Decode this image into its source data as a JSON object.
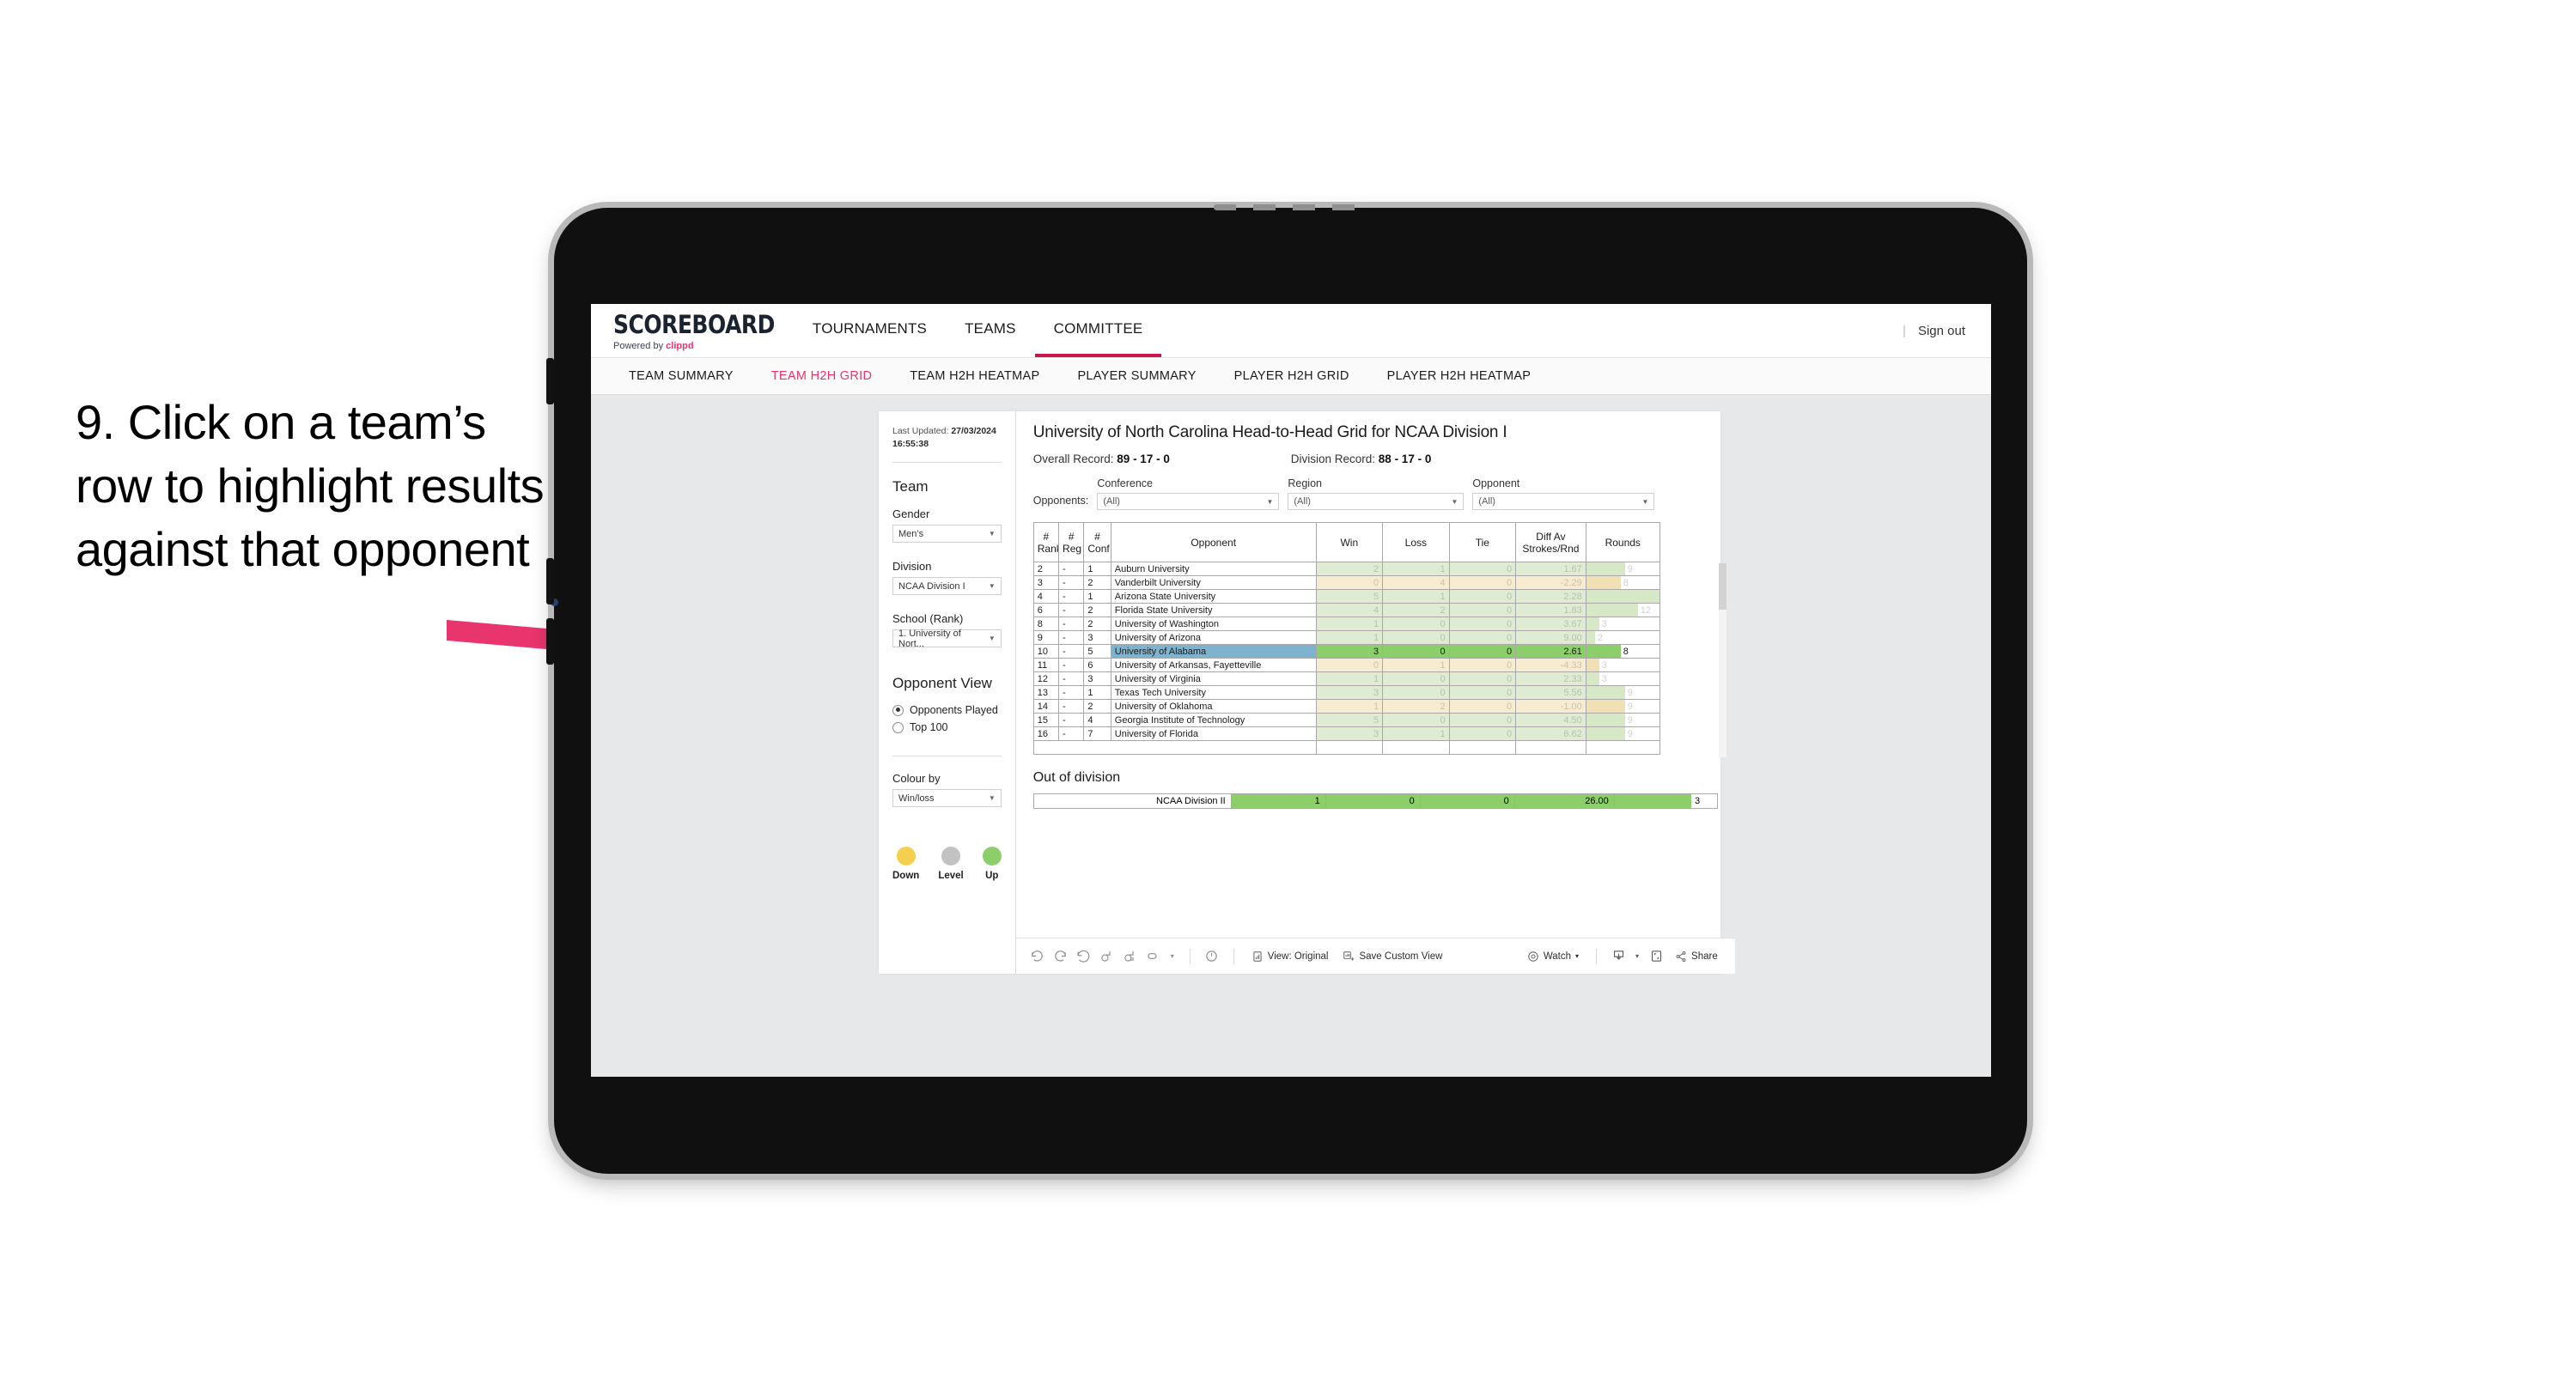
{
  "annotation": {
    "text": "9. Click on a team’s row to highlight results against that opponent",
    "arrow_color": "#e8356d"
  },
  "app": {
    "brand": {
      "title": "SCOREBOARD",
      "powered_prefix": "Powered by ",
      "powered_name": "clippd"
    },
    "topnav": [
      {
        "label": "TOURNAMENTS",
        "active": false
      },
      {
        "label": "TEAMS",
        "active": false
      },
      {
        "label": "COMMITTEE",
        "active": true
      }
    ],
    "topbar_right": {
      "divider": "|",
      "sign_out": "Sign out"
    },
    "subnav": [
      {
        "label": "TEAM SUMMARY",
        "active": false
      },
      {
        "label": "TEAM H2H GRID",
        "active": true
      },
      {
        "label": "TEAM H2H HEATMAP",
        "active": false
      },
      {
        "label": "PLAYER SUMMARY",
        "active": false
      },
      {
        "label": "PLAYER H2H GRID",
        "active": false
      },
      {
        "label": "PLAYER H2H HEATMAP",
        "active": false
      }
    ]
  },
  "sidebar": {
    "last_updated_label": "Last Updated:",
    "last_updated_value": "27/03/2024 16:55:38",
    "team_heading": "Team",
    "gender_label": "Gender",
    "gender_value": "Men’s",
    "division_label": "Division",
    "division_value": "NCAA Division I",
    "school_label": "School (Rank)",
    "school_value": "1. University of Nort...",
    "opponent_view_heading": "Opponent View",
    "opponent_view_options": [
      {
        "label": "Opponents Played",
        "selected": true
      },
      {
        "label": "Top 100",
        "selected": false
      }
    ],
    "colour_by_label": "Colour by",
    "colour_by_value": "Win/loss",
    "legend": [
      {
        "label": "Down",
        "color": "#f5d04e"
      },
      {
        "label": "Level",
        "color": "#c2c2c2"
      },
      {
        "label": "Up",
        "color": "#8cce6a"
      }
    ]
  },
  "viz": {
    "title": "University of North Carolina Head-to-Head Grid for NCAA Division I",
    "overall_record_label": "Overall Record:",
    "overall_record_value": "89 - 17 - 0",
    "division_record_label": "Division Record:",
    "division_record_value": "88 - 17 - 0",
    "opponents_label": "Opponents:",
    "filters": [
      {
        "label": "Conference",
        "value": "(All)"
      },
      {
        "label": "Region",
        "value": "(All)"
      },
      {
        "label": "Opponent",
        "value": "(All)"
      }
    ],
    "columns": [
      {
        "l1": "#",
        "l2": "Rank"
      },
      {
        "l1": "#",
        "l2": "Reg"
      },
      {
        "l1": "#",
        "l2": "Conf"
      },
      {
        "l1": "Opponent",
        "l2": ""
      },
      {
        "l1": "Win",
        "l2": ""
      },
      {
        "l1": "Loss",
        "l2": ""
      },
      {
        "l1": "Tie",
        "l2": ""
      },
      {
        "l1": "Diff Av",
        "l2": "Strokes/Rnd"
      },
      {
        "l1": "Rounds",
        "l2": ""
      }
    ],
    "rows": [
      {
        "rank": "2",
        "reg": "-",
        "conf": "1",
        "opponent": "Auburn University",
        "win": "2",
        "loss": "1",
        "tie": "0",
        "diff": "1.67",
        "rounds": "9",
        "state": "up",
        "selected": false
      },
      {
        "rank": "3",
        "reg": "-",
        "conf": "2",
        "opponent": "Vanderbilt University",
        "win": "0",
        "loss": "4",
        "tie": "0",
        "diff": "-2.29",
        "rounds": "8",
        "state": "down",
        "selected": false
      },
      {
        "rank": "4",
        "reg": "-",
        "conf": "1",
        "opponent": "Arizona State University",
        "win": "5",
        "loss": "1",
        "tie": "0",
        "diff": "2.28",
        "rounds": "17",
        "state": "up",
        "selected": false
      },
      {
        "rank": "6",
        "reg": "-",
        "conf": "2",
        "opponent": "Florida State University",
        "win": "4",
        "loss": "2",
        "tie": "0",
        "diff": "1.83",
        "rounds": "12",
        "state": "up",
        "selected": false
      },
      {
        "rank": "8",
        "reg": "-",
        "conf": "2",
        "opponent": "University of Washington",
        "win": "1",
        "loss": "0",
        "tie": "0",
        "diff": "3.67",
        "rounds": "3",
        "state": "up",
        "selected": false
      },
      {
        "rank": "9",
        "reg": "-",
        "conf": "3",
        "opponent": "University of Arizona",
        "win": "1",
        "loss": "0",
        "tie": "0",
        "diff": "9.00",
        "rounds": "2",
        "state": "up",
        "selected": false
      },
      {
        "rank": "10",
        "reg": "-",
        "conf": "5",
        "opponent": "University of Alabama",
        "win": "3",
        "loss": "0",
        "tie": "0",
        "diff": "2.61",
        "rounds": "8",
        "state": "up",
        "selected": true
      },
      {
        "rank": "11",
        "reg": "-",
        "conf": "6",
        "opponent": "University of Arkansas, Fayetteville",
        "win": "0",
        "loss": "1",
        "tie": "0",
        "diff": "-4.33",
        "rounds": "3",
        "state": "down",
        "selected": false
      },
      {
        "rank": "12",
        "reg": "-",
        "conf": "3",
        "opponent": "University of Virginia",
        "win": "1",
        "loss": "0",
        "tie": "0",
        "diff": "2.33",
        "rounds": "3",
        "state": "up",
        "selected": false
      },
      {
        "rank": "13",
        "reg": "-",
        "conf": "1",
        "opponent": "Texas Tech University",
        "win": "3",
        "loss": "0",
        "tie": "0",
        "diff": "5.56",
        "rounds": "9",
        "state": "up",
        "selected": false
      },
      {
        "rank": "14",
        "reg": "-",
        "conf": "2",
        "opponent": "University of Oklahoma",
        "win": "1",
        "loss": "2",
        "tie": "0",
        "diff": "-1.00",
        "rounds": "9",
        "state": "down",
        "selected": false
      },
      {
        "rank": "15",
        "reg": "-",
        "conf": "4",
        "opponent": "Georgia Institute of Technology",
        "win": "5",
        "loss": "0",
        "tie": "0",
        "diff": "4.50",
        "rounds": "9",
        "state": "up",
        "selected": false
      },
      {
        "rank": "16",
        "reg": "-",
        "conf": "7",
        "opponent": "University of Florida",
        "win": "3",
        "loss": "1",
        "tie": "0",
        "diff": "6.62",
        "rounds": "9",
        "state": "up",
        "selected": false
      }
    ],
    "out_of_division": {
      "heading": "Out of division",
      "row": {
        "name": "NCAA Division II",
        "win": "1",
        "loss": "0",
        "tie": "0",
        "diff": "26.00",
        "rounds": "3"
      }
    }
  },
  "toolbar": {
    "icons": [
      "undo-icon",
      "redo-icon",
      "revert-icon",
      "refresh-icon",
      "pause-icon",
      "alerts-icon"
    ],
    "dropdown_caret": "▾",
    "view_original": "View: Original",
    "save_custom_view": "Save Custom View",
    "watch": "Watch",
    "share": "Share"
  },
  "chart_data": {
    "type": "table",
    "title": "University of North Carolina Head-to-Head Grid for NCAA Division I",
    "columns": [
      "# Rank",
      "# Reg",
      "# Conf",
      "Opponent",
      "Win",
      "Loss",
      "Tie",
      "Diff Av Strokes/Rnd",
      "Rounds"
    ],
    "rows": [
      [
        "2",
        "-",
        "1",
        "Auburn University",
        2,
        1,
        0,
        1.67,
        9
      ],
      [
        "3",
        "-",
        "2",
        "Vanderbilt University",
        0,
        4,
        0,
        -2.29,
        8
      ],
      [
        "4",
        "-",
        "1",
        "Arizona State University",
        5,
        1,
        0,
        2.28,
        17
      ],
      [
        "6",
        "-",
        "2",
        "Florida State University",
        4,
        2,
        0,
        1.83,
        12
      ],
      [
        "8",
        "-",
        "2",
        "University of Washington",
        1,
        0,
        0,
        3.67,
        3
      ],
      [
        "9",
        "-",
        "3",
        "University of Arizona",
        1,
        0,
        0,
        9.0,
        2
      ],
      [
        "10",
        "-",
        "5",
        "University of Alabama",
        3,
        0,
        0,
        2.61,
        8
      ],
      [
        "11",
        "-",
        "6",
        "University of Arkansas, Fayetteville",
        0,
        1,
        0,
        -4.33,
        3
      ],
      [
        "12",
        "-",
        "3",
        "University of Virginia",
        1,
        0,
        0,
        2.33,
        3
      ],
      [
        "13",
        "-",
        "1",
        "Texas Tech University",
        3,
        0,
        0,
        5.56,
        9
      ],
      [
        "14",
        "-",
        "2",
        "University of Oklahoma",
        1,
        2,
        0,
        -1.0,
        9
      ],
      [
        "15",
        "-",
        "4",
        "Georgia Institute of Technology",
        5,
        0,
        0,
        4.5,
        9
      ],
      [
        "16",
        "-",
        "7",
        "University of Florida",
        3,
        1,
        0,
        6.62,
        9
      ]
    ],
    "out_of_division_rows": [
      [
        "NCAA Division II",
        1,
        0,
        0,
        26.0,
        3
      ]
    ],
    "rounds_max": 17,
    "colour_by": "Win/loss",
    "legend": [
      {
        "label": "Down",
        "color": "#f5d04e"
      },
      {
        "label": "Level",
        "color": "#c2c2c2"
      },
      {
        "label": "Up",
        "color": "#8cce6a"
      }
    ],
    "selected_row": "University of Alabama"
  }
}
